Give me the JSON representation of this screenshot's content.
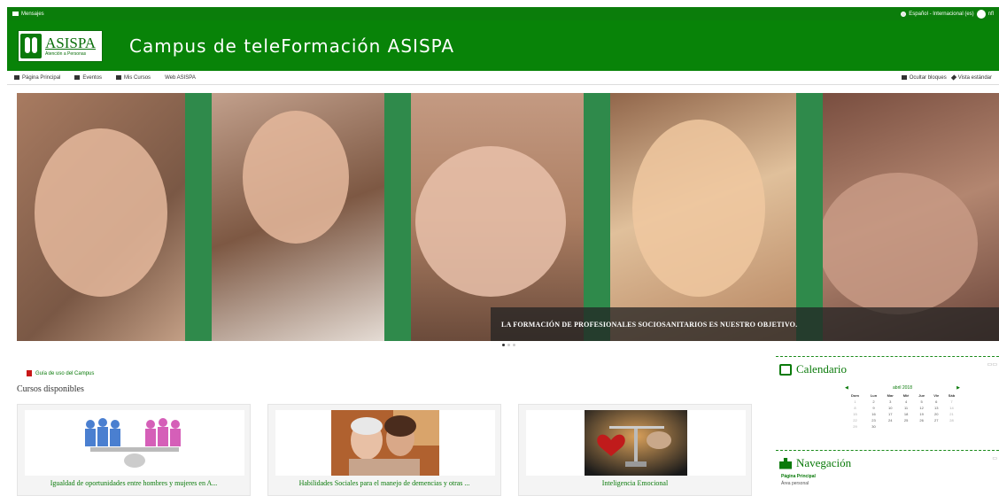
{
  "topbar": {
    "messages": "Mensajes",
    "language": "Español - Internacional (es)",
    "user": "nfl"
  },
  "header": {
    "logo_brand": "ASISPA",
    "logo_tagline": "Atención a Personas",
    "site_title": "Campus de teleFormación ASISPA"
  },
  "nav": {
    "items": [
      "Página Principal",
      "Eventos",
      "Mis Cursos",
      "Web ASISPA"
    ],
    "right": [
      "Ocultar bloques",
      "Vista estándar"
    ]
  },
  "slider": {
    "caption": "LA FORMACIÓN DE PROFESIONALES SOCIOSANITARIOS ES NUESTRO OBJETIVO."
  },
  "main": {
    "guide_link": "Guía de uso del Campus",
    "courses_heading": "Cursos disponibles",
    "courses": [
      {
        "title": "Igualdad de oportunidades entre hombres y mujeres en A..."
      },
      {
        "title": "Habilidades Sociales para el manejo de demencias y otras ..."
      },
      {
        "title": "Inteligencia Emocional"
      }
    ]
  },
  "calendar": {
    "title": "Calendario",
    "month": "abril 2018",
    "days": [
      "Dom",
      "Lun",
      "Mar",
      "Mié",
      "Jue",
      "Vie",
      "Sáb"
    ],
    "weeks": [
      [
        "1",
        "2",
        "3",
        "4",
        "5",
        "6",
        "7"
      ],
      [
        "8",
        "9",
        "10",
        "11",
        "12",
        "13",
        "14"
      ],
      [
        "15",
        "16",
        "17",
        "18",
        "19",
        "20",
        "21"
      ],
      [
        "22",
        "23",
        "24",
        "25",
        "26",
        "27",
        "28"
      ],
      [
        "29",
        "30",
        "",
        "",
        "",
        "",
        ""
      ]
    ]
  },
  "navigation": {
    "title": "Navegación",
    "home": "Página Principal",
    "item": "Área personal"
  },
  "colors": {
    "brand_green": "#088308",
    "link_green": "#0a7a0a"
  }
}
